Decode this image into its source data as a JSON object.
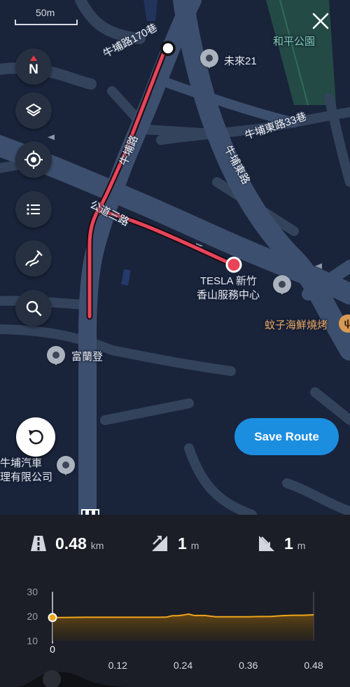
{
  "map": {
    "scale_label": "50m",
    "roads": [
      {
        "name": "牛埔路170巷"
      },
      {
        "name": "牛埔路"
      },
      {
        "name": "公道三路"
      },
      {
        "name": "牛埔東路"
      },
      {
        "name": "牛埔東路33巷"
      }
    ],
    "places": [
      {
        "name": "和平公園"
      },
      {
        "name": "未來21"
      },
      {
        "name_line1": "TESLA 新竹",
        "name_line2": "香山服務中心"
      },
      {
        "name": "蚊子海鮮燒烤"
      },
      {
        "name": "富蘭登"
      },
      {
        "name_line1": "牛埔汽車",
        "name_line2": "理有限公司"
      }
    ],
    "icons": {
      "compass_letter": "N",
      "layers": "layers-icon",
      "locate": "crosshair-icon",
      "list": "list-icon",
      "route_draw": "route-draw-icon",
      "search": "search-icon",
      "close": "close-icon",
      "undo": "undo-icon",
      "food": "ψ"
    }
  },
  "actions": {
    "save_route": "Save Route"
  },
  "stats": {
    "distance": {
      "value": "0.48",
      "unit": "km"
    },
    "ascent": {
      "value": "1",
      "unit": "m"
    },
    "descent": {
      "value": "1",
      "unit": "m"
    }
  },
  "colors": {
    "route": "#e8455a",
    "elevation_line": "#f0a51c",
    "accent": "#1c8ee0"
  },
  "chart_data": {
    "type": "area",
    "xlabel": "",
    "ylabel": "",
    "x": [
      0,
      0.02,
      0.06,
      0.1,
      0.14,
      0.18,
      0.2,
      0.21,
      0.22,
      0.23,
      0.24,
      0.25,
      0.26,
      0.28,
      0.3,
      0.32,
      0.34,
      0.36,
      0.38,
      0.4,
      0.42,
      0.44,
      0.46,
      0.48
    ],
    "y": [
      19.5,
      19.5,
      19.6,
      19.6,
      19.6,
      19.6,
      19.6,
      19.7,
      20.2,
      20.2,
      20.5,
      20.9,
      20.3,
      20.3,
      19.8,
      19.8,
      19.8,
      19.8,
      19.9,
      19.9,
      20.2,
      20.4,
      20.4,
      20.6
    ],
    "xlim": [
      0,
      0.48
    ],
    "ylim": [
      10,
      30
    ],
    "yticks": [
      "30",
      "20",
      "10"
    ],
    "xticks": [
      "0",
      "0.12",
      "0.24",
      "0.36",
      "0.48"
    ],
    "grid": false
  }
}
